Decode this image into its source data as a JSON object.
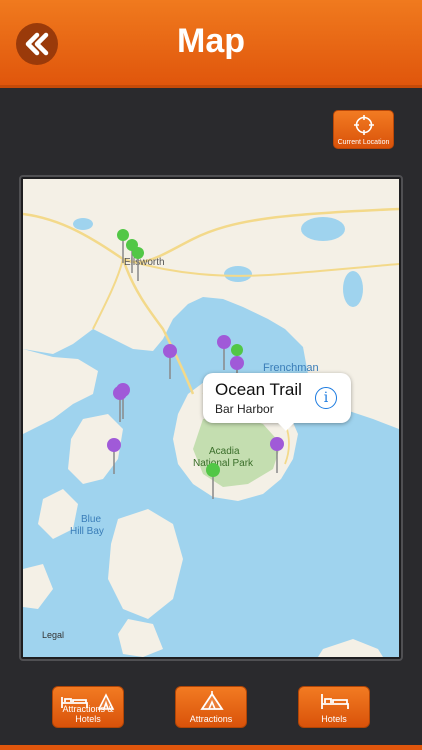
{
  "header": {
    "title": "Map",
    "back_icon": "double-chevron-left-icon"
  },
  "current_location": {
    "label": "Current Location",
    "icon": "crosshair-icon"
  },
  "map": {
    "place_labels": {
      "ellsworth": "Ellsworth",
      "frenchman": "Frenchman",
      "acadia_1": "Acadia",
      "acadia_2": "National Park",
      "blue": "Blue",
      "hill_bay": "Hill Bay",
      "legal": "Legal"
    },
    "callout": {
      "title": "Ocean Trail",
      "subtitle": "Bar Harbor",
      "icon": "info-icon"
    },
    "pin_colors": {
      "hotel": "#a05ad8",
      "attraction": "#52c746"
    }
  },
  "tabs": [
    {
      "label": "Attractions & Hotels",
      "icon": "bed-and-tent-icon"
    },
    {
      "label": "Attractions",
      "icon": "tent-icon"
    },
    {
      "label": "Hotels",
      "icon": "bed-icon"
    }
  ],
  "colors": {
    "accent": "#e8650f",
    "water": "#9fd3ee",
    "land": "#f4f0e6",
    "park": "#c4deb0"
  }
}
